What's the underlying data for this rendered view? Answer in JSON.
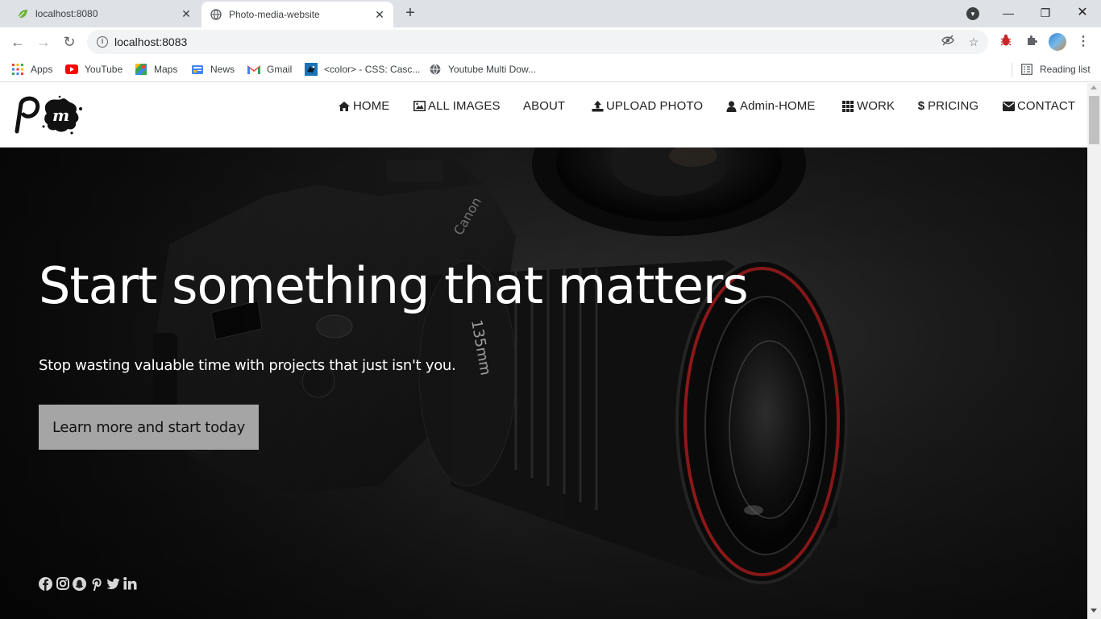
{
  "browser": {
    "tabs": [
      {
        "title": "localhost:8080",
        "favicon": "spring-leaf-icon"
      },
      {
        "title": "Photo-media-website",
        "favicon": "globe-icon",
        "active": true
      }
    ],
    "url": "localhost:8083",
    "bookmarks": [
      {
        "label": "Apps",
        "icon": "apps-grid-icon"
      },
      {
        "label": "YouTube",
        "icon": "youtube-icon"
      },
      {
        "label": "Maps",
        "icon": "maps-icon"
      },
      {
        "label": "News",
        "icon": "news-icon"
      },
      {
        "label": "Gmail",
        "icon": "gmail-icon"
      },
      {
        "label": "<color> - CSS: Casc...",
        "icon": "mdn-icon"
      },
      {
        "label": "Youtube Multi Dow...",
        "icon": "globe-icon"
      }
    ],
    "reading_list": "Reading list"
  },
  "site": {
    "nav": [
      {
        "label": "HOME",
        "icon": "home-icon"
      },
      {
        "label": "ALL IMAGES",
        "icon": "image-icon"
      },
      {
        "label": "ABOUT",
        "icon": ""
      },
      {
        "label": "UPLOAD PHOTO",
        "icon": "upload-icon"
      },
      {
        "label": "Admin-HOME",
        "icon": "user-icon"
      },
      {
        "label": "WORK",
        "icon": "grid-icon"
      },
      {
        "label": "PRICING",
        "icon": "dollar-icon"
      },
      {
        "label": "CONTACT",
        "icon": "envelope-icon"
      }
    ],
    "hero": {
      "title": "Start something that matters",
      "subtitle": "Stop wasting valuable time with projects that just isn't you.",
      "button": "Learn more and start today"
    },
    "socials": [
      "facebook-icon",
      "instagram-icon",
      "snapchat-icon",
      "pinterest-icon",
      "twitter-icon",
      "linkedin-icon"
    ]
  },
  "colors": {
    "chrome_bg": "#dee1e6",
    "omnibox_bg": "#f1f3f4",
    "hero_button_bg": "#a5a5a5",
    "hero_text": "#ffffff"
  }
}
